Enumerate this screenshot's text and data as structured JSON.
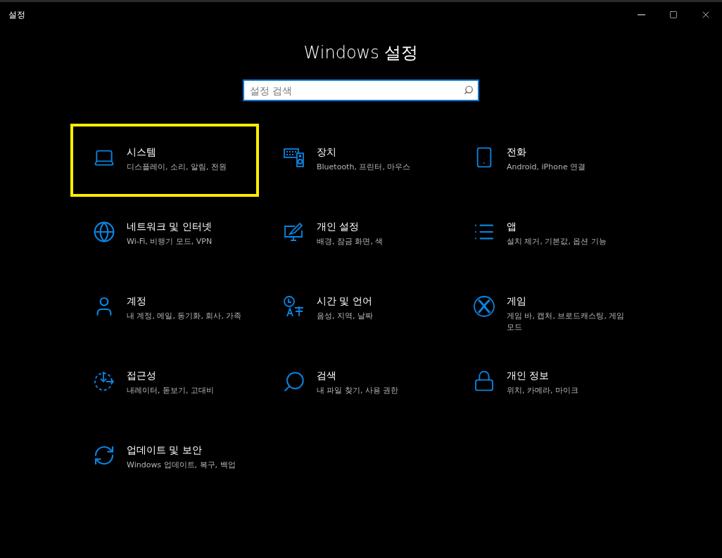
{
  "window": {
    "title": "설정"
  },
  "heading": "Windows 설정",
  "search": {
    "placeholder": "설정 검색"
  },
  "categories": [
    {
      "kind": "system",
      "title": "시스템",
      "description": "디스플레이, 소리, 알림, 전원",
      "selected": true
    },
    {
      "kind": "devices",
      "title": "장치",
      "description": "Bluetooth, 프린터, 마우스",
      "selected": false
    },
    {
      "kind": "phone",
      "title": "전화",
      "description": "Android, iPhone 연결",
      "selected": false
    },
    {
      "kind": "network",
      "title": "네트워크 및 인터넷",
      "description": "Wi-Fi, 비행기 모드, VPN",
      "selected": false
    },
    {
      "kind": "personalization",
      "title": "개인 설정",
      "description": "배경, 잠금 화면, 색",
      "selected": false
    },
    {
      "kind": "apps",
      "title": "앱",
      "description": "설치 제거, 기본값, 옵션 기능",
      "selected": false
    },
    {
      "kind": "accounts",
      "title": "계정",
      "description": "내 계정, 메일, 동기화, 회사, 가족",
      "selected": false
    },
    {
      "kind": "time",
      "title": "시간 및 언어",
      "description": "음성, 지역, 날짜",
      "selected": false
    },
    {
      "kind": "gaming",
      "title": "게임",
      "description": "게임 바, 캡처, 브로드캐스팅, 게임 모드",
      "selected": false
    },
    {
      "kind": "access",
      "title": "접근성",
      "description": "내레이터, 돋보기, 고대비",
      "selected": false
    },
    {
      "kind": "search",
      "title": "검색",
      "description": "내 파일 찾기, 사용 권한",
      "selected": false
    },
    {
      "kind": "privacy",
      "title": "개인 정보",
      "description": "위치, 카메라, 마이크",
      "selected": false
    },
    {
      "kind": "update",
      "title": "업데이트 및 보안",
      "description": "Windows 업데이트, 복구, 백업",
      "selected": false
    }
  ]
}
